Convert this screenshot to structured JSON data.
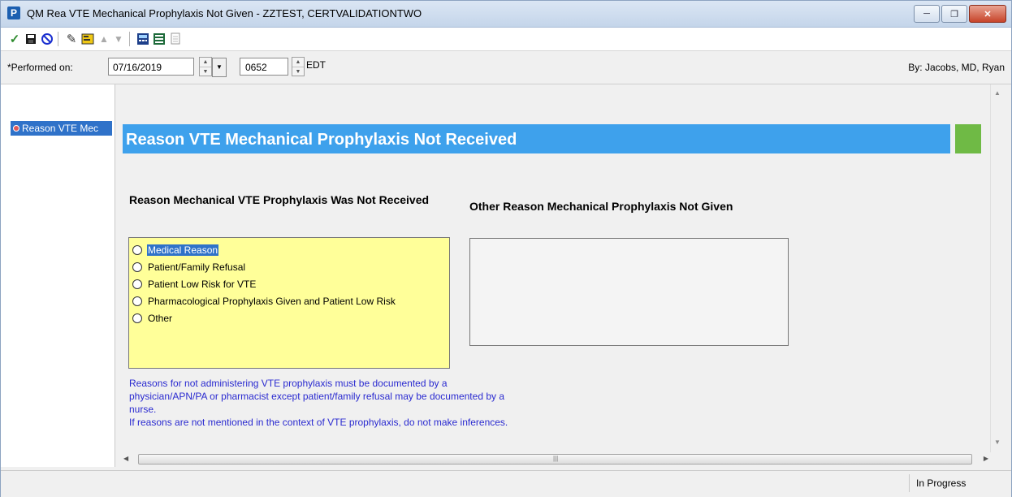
{
  "window": {
    "title": "QM Rea VTE Mechanical Prophylaxis Not Given - ZZTEST, CERTVALIDATIONTWO",
    "app_icon_letter": "P"
  },
  "toolbar": {
    "icons": [
      "sign-checkmark-icon",
      "save-icon",
      "cancel-icon",
      "tag-icon",
      "form-browser-icon",
      "arrow-up-icon",
      "arrow-down-icon",
      "calculator-icon",
      "reference-icon",
      "copy-document-icon"
    ]
  },
  "performed": {
    "label": "*Performed on:",
    "date": "07/16/2019",
    "time": "0652",
    "timezone": "EDT",
    "by": "By:  Jacobs, MD, Ryan"
  },
  "nav": {
    "items": [
      {
        "label": "Reason VTE Mec"
      }
    ]
  },
  "form": {
    "section_title": "Reason VTE Mechanical Prophylaxis Not Received",
    "q1_label": "Reason Mechanical VTE Prophylaxis Was Not Received",
    "q2_label": "Other Reason Mechanical Prophylaxis Not Given",
    "options": [
      {
        "label": "Medical Reason",
        "selected": true
      },
      {
        "label": "Patient/Family Refusal",
        "selected": false
      },
      {
        "label": "Patient Low Risk for VTE",
        "selected": false
      },
      {
        "label": "Pharmacological Prophylaxis Given and Patient Low Risk",
        "selected": false
      },
      {
        "label": "Other",
        "selected": false
      }
    ],
    "note_lines": [
      "Reasons for not administering VTE prophylaxis must be documented by a",
      "physician/APN/PA or pharmacist except patient/family refusal may be documented by a",
      "nurse.",
      "If reasons are not mentioned in the context of VTE prophylaxis, do not make inferences."
    ],
    "note_color": "#2a2ad0",
    "section_color": "#3ea1ec",
    "status_indicator_color": "#6fba45"
  },
  "status": {
    "text": "In Progress"
  }
}
